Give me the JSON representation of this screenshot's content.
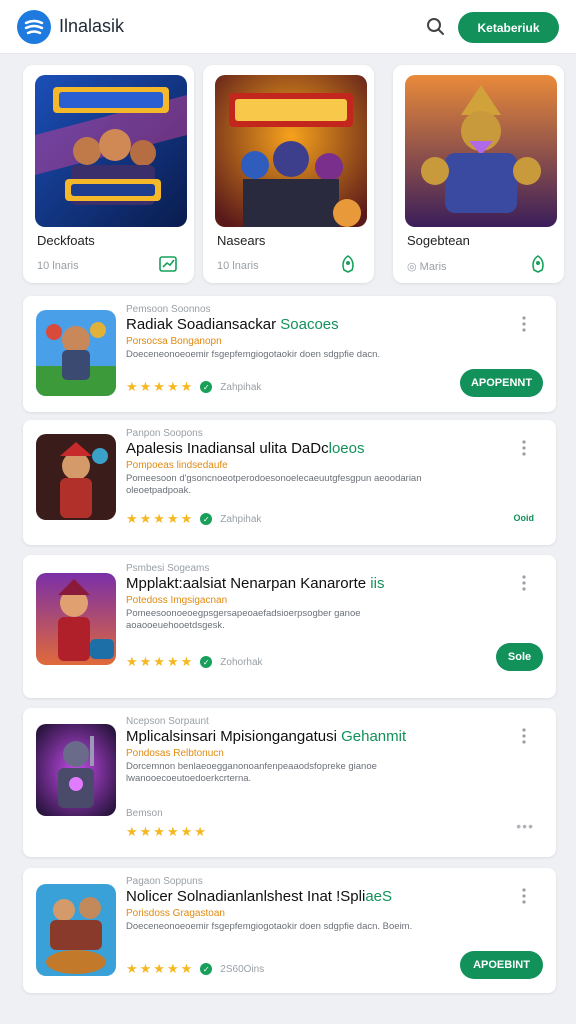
{
  "header": {
    "brand": "Ilnalasik",
    "action_label": "Ketaberiuk"
  },
  "featured": [
    {
      "title": "Deckfoats",
      "meta": "10 lnaris",
      "icon": "trending-chart-icon"
    },
    {
      "title": "Nasears",
      "meta": "10 lnaris",
      "icon": "pin-icon"
    },
    {
      "title": "Sogebtean",
      "meta": "◎ Maris",
      "icon": "pin-icon"
    }
  ],
  "list": [
    {
      "kicker": "Pemsoon Soonnos",
      "title": "Radiak Soadiansackar ",
      "title_hl": "Soacoes",
      "sub": "Porsocsa Bonganopn",
      "desc": "Doeceneonoeoemir fsgepfemgiogotaokir doen sdgpfie dacn.",
      "stars": "★★★★★",
      "verified": true,
      "count": "Zahpihak",
      "action": "APOPENNT",
      "action_type": "button"
    },
    {
      "kicker": "Panpon Soopons",
      "title": "Apalesis Inadiansal ulita DaDc",
      "title_hl": "loeos",
      "sub": "Pompoeas lindsedaufe",
      "desc": "Pomeesoon d'gsoncnoeotperodoesonoelecaeuutgfesgpun aeoodarian oleoetpadpoak.",
      "stars": "★★★★★",
      "verified": true,
      "count": "Zahpihak",
      "action": "Ooid",
      "action_type": "link"
    },
    {
      "kicker": "Psmbesi Sogeams",
      "title": "Mpplakt:aalsiat Nenarpan Kanarorte",
      "title_hl": " iis",
      "sub": "Potedoss Imgsigacnan",
      "desc": "Pomeesoonoeoegpsgersapeoaefadsioerpsogber ganoe aoaooeuehooetdsgesk.",
      "stars": "★★★★★",
      "verified": true,
      "count": "Zohorhak",
      "action": "Sole",
      "action_type": "button"
    },
    {
      "kicker": "Ncepson Sorpaunt",
      "title": "Mplicalsinsari Mpisiongangatusi ",
      "title_hl": "Gehanmit",
      "sub": "Pondosas Relbtonucn",
      "desc": "Dorcemnon benlaeoegganonoanfenpeaaodsfopreke gianoe lwanooecoeutoedoerkcrterna.",
      "extra": "Bemson",
      "stars": "★★★★★★",
      "verified": false,
      "count": "",
      "action": "•••",
      "action_type": "dots"
    },
    {
      "kicker": "Pagaon Soppuns",
      "title": "Nolicer Solnadianlanlshest Inat !Spli",
      "title_hl": "aeS",
      "sub": "Porisdoss Gragastoan",
      "desc": "Doeceneonoeoemir fsgepfemgiogotaokir doen sdgpfie dacn. Boeim.",
      "stars": "★★★★★",
      "verified": true,
      "count": "2S60Oins",
      "action": "APOEBINT",
      "action_type": "button"
    }
  ],
  "colors": {
    "accent": "#12915a",
    "brand_blue": "#1f7ae0",
    "star": "#f5b820",
    "sub_orange": "#e08a10"
  }
}
